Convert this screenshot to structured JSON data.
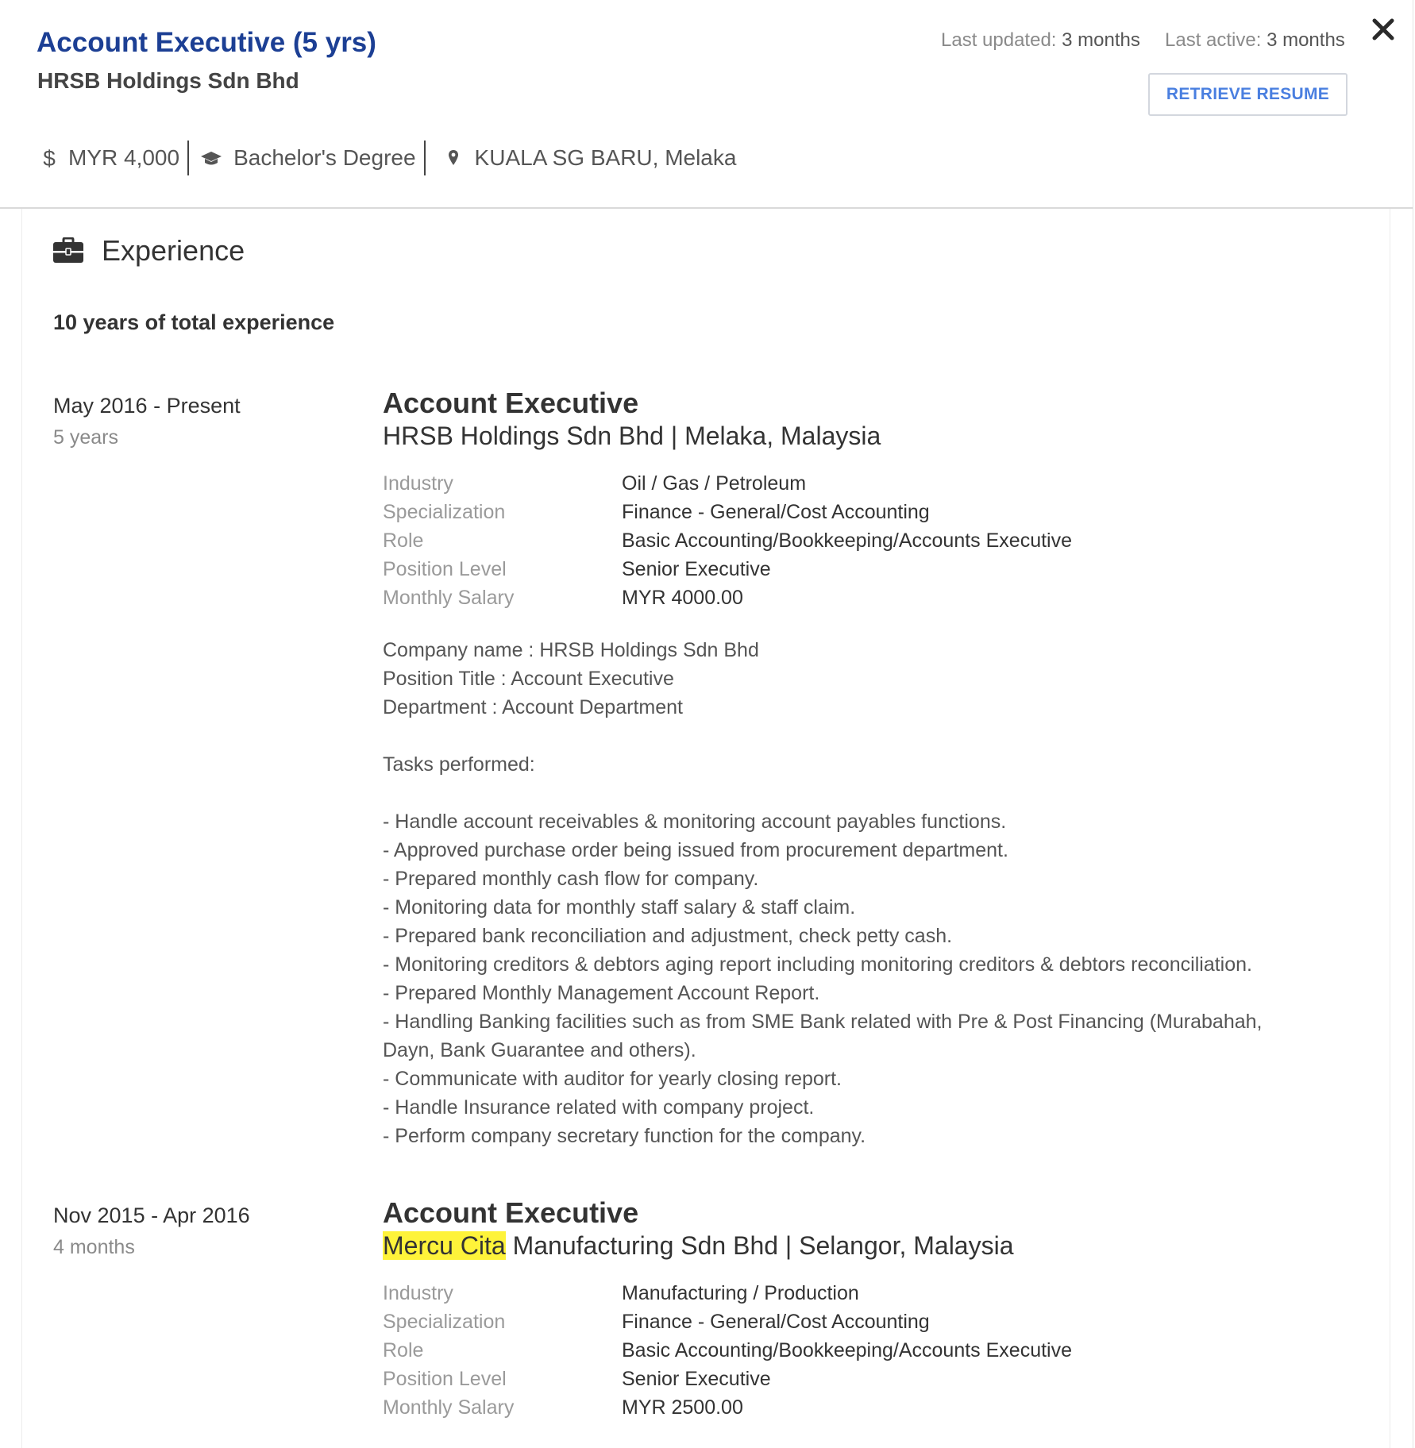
{
  "header": {
    "title": "Account Executive (5 yrs)",
    "company": "HRSB Holdings Sdn Bhd",
    "last_updated_label": "Last updated:",
    "last_updated_value": " 3 months",
    "last_active_label": "Last active:",
    "last_active_value": " 3 months",
    "retrieve_label": "RETRIEVE RESUME",
    "salary": "MYR 4,000",
    "education": "Bachelor's Degree",
    "location": "KUALA SG BARU, Melaka"
  },
  "experience": {
    "section_title": "Experience",
    "total": "10 years of total experience",
    "labels": {
      "industry": "Industry",
      "specialization": "Specialization",
      "role": "Role",
      "position_level": "Position Level",
      "monthly_salary": "Monthly Salary"
    },
    "entries": [
      {
        "date_range": "May 2016 - Present",
        "duration": "5 years",
        "title": "Account Executive",
        "company_highlight": "",
        "company_rest": "HRSB Holdings Sdn Bhd | Melaka, Malaysia",
        "industry": "Oil / Gas / Petroleum",
        "specialization": "Finance - General/Cost Accounting",
        "role": "Basic Accounting/Bookkeeping/Accounts Executive",
        "position_level": "Senior Executive",
        "monthly_salary": "MYR 4000.00",
        "description": [
          "Company name : HRSB Holdings Sdn Bhd",
          "Position Title : Account Executive",
          "Department : Account Department",
          "",
          "Tasks performed:",
          "",
          "- Handle account receivables & monitoring account payables functions.",
          "- Approved purchase order being issued from procurement department.",
          "- Prepared monthly cash flow for company.",
          "- Monitoring data for monthly staff salary & staff claim.",
          "- Prepared bank reconciliation and adjustment, check petty cash.",
          "- Monitoring creditors & debtors aging report including monitoring creditors & debtors reconciliation.",
          "- Prepared Monthly Management Account Report.",
          "- Handling Banking facilities such as from SME Bank related with Pre & Post Financing (Murabahah,",
          "Dayn, Bank Guarantee and others).",
          "- Communicate with auditor for yearly closing report.",
          "- Handle Insurance related with company project.",
          "- Perform company secretary function for the company."
        ]
      },
      {
        "date_range": "Nov 2015 - Apr 2016",
        "duration": "4 months",
        "title": "Account Executive",
        "company_highlight": "Mercu Cita",
        "company_rest": " Manufacturing Sdn Bhd | Selangor, Malaysia",
        "industry": "Manufacturing / Production",
        "specialization": "Finance - General/Cost Accounting",
        "role": "Basic Accounting/Bookkeeping/Accounts Executive",
        "position_level": "Senior Executive",
        "monthly_salary": "MYR 2500.00",
        "description": []
      }
    ]
  },
  "colors": {
    "title_blue": "#1c3f94",
    "button_blue": "#4a7fe0",
    "highlight_yellow": "#fef33a"
  },
  "icons": [
    "close-icon",
    "dollar-icon",
    "graduation-cap-icon",
    "map-pin-icon",
    "briefcase-icon"
  ]
}
